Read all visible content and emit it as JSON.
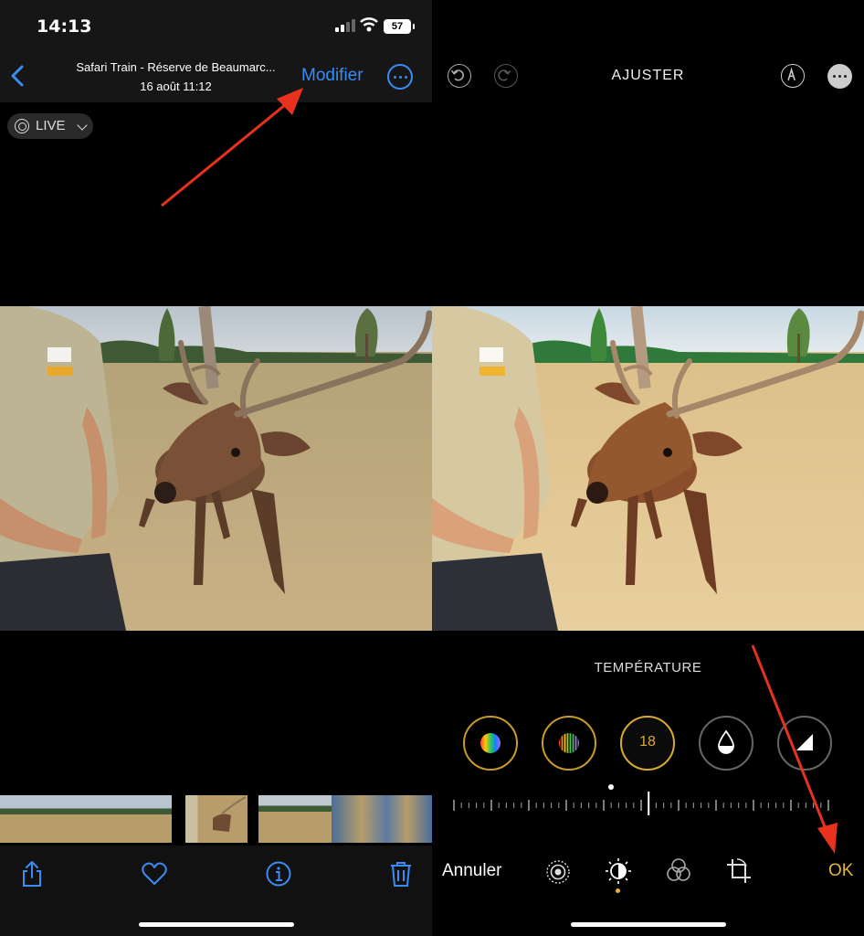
{
  "left": {
    "status_bar": {
      "time": "14:13",
      "battery": "57"
    },
    "nav": {
      "title": "Safari Train - Réserve de Beaumarc...",
      "subtitle": "16 août  11:12",
      "edit_label": "Modifier"
    },
    "live_label": "LIVE",
    "toolbar_icons": [
      "share-icon",
      "heart-icon",
      "info-icon",
      "trash-icon"
    ]
  },
  "right": {
    "header_title": "AJUSTER",
    "adjust_label": "TEMPÉRATURE",
    "tools": [
      {
        "name": "rainbow-circle-tool",
        "value": ""
      },
      {
        "name": "stripes-tool",
        "value": ""
      },
      {
        "name": "temperature-tool",
        "value": "18"
      },
      {
        "name": "tint-drop-tool",
        "value": ""
      },
      {
        "name": "sharpness-tool",
        "value": ""
      }
    ],
    "cancel_label": "Annuler",
    "done_label": "OK"
  },
  "colors": {
    "accent_blue": "#3a8cf5",
    "accent_gold": "#e3b43c",
    "annotation_red": "#e8321e"
  }
}
